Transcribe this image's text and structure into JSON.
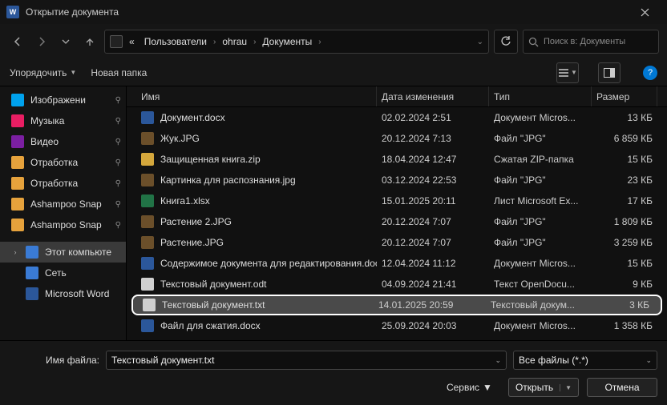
{
  "window": {
    "title": "Открытие документа"
  },
  "breadcrumbs": {
    "root": "«",
    "a": "Пользователи",
    "b": "ohrau",
    "c": "Документы"
  },
  "search": {
    "placeholder": "Поиск в: Документы"
  },
  "toolbar": {
    "organize": "Упорядочить",
    "newfolder": "Новая папка"
  },
  "columns": {
    "name": "Имя",
    "date": "Дата изменения",
    "type": "Тип",
    "size": "Размер"
  },
  "sidebar": {
    "items": [
      {
        "label": "Изображени",
        "icon": "#00a2ed",
        "pin": true
      },
      {
        "label": "Музыка",
        "icon": "#e91e63",
        "pin": true
      },
      {
        "label": "Видео",
        "icon": "#7b1fa2",
        "pin": true
      },
      {
        "label": "Отработка",
        "icon": "#e6a23c",
        "pin": true
      },
      {
        "label": "Отработка",
        "icon": "#e6a23c",
        "pin": true
      },
      {
        "label": "Ashampoo Snap",
        "icon": "#e6a23c",
        "pin": true
      },
      {
        "label": "Ashampoo Snap",
        "icon": "#e6a23c",
        "pin": true
      }
    ],
    "pc": {
      "label": "Этот компьюте",
      "icon": "#3a7bd5"
    },
    "net": {
      "label": "Сеть",
      "icon": "#3a7bd5"
    },
    "word": {
      "label": "Microsoft Word",
      "icon": "#2b579a"
    }
  },
  "files": [
    {
      "name": "Документ.docx",
      "date": "02.02.2024 2:51",
      "type": "Документ Micros...",
      "size": "13 КБ",
      "ic": "#2b579a"
    },
    {
      "name": "Жук.JPG",
      "date": "20.12.2024 7:13",
      "type": "Файл \"JPG\"",
      "size": "6 859 КБ",
      "ic": "#6b4f2a"
    },
    {
      "name": "Защищенная книга.zip",
      "date": "18.04.2024 12:47",
      "type": "Сжатая ZIP-папка",
      "size": "15 КБ",
      "ic": "#d4a73c"
    },
    {
      "name": "Картинка для распознания.jpg",
      "date": "03.12.2024 22:53",
      "type": "Файл \"JPG\"",
      "size": "23 КБ",
      "ic": "#6b4f2a"
    },
    {
      "name": "Книга1.xlsx",
      "date": "15.01.2025 20:11",
      "type": "Лист Microsoft Ex...",
      "size": "17 КБ",
      "ic": "#217346"
    },
    {
      "name": "Растение 2.JPG",
      "date": "20.12.2024 7:07",
      "type": "Файл \"JPG\"",
      "size": "1 809 КБ",
      "ic": "#6b4f2a"
    },
    {
      "name": "Растение.JPG",
      "date": "20.12.2024 7:07",
      "type": "Файл \"JPG\"",
      "size": "3 259 КБ",
      "ic": "#6b4f2a"
    },
    {
      "name": "Содержимое документа для редактирования.docx",
      "date": "12.04.2024 11:12",
      "type": "Документ Micros...",
      "size": "15 КБ",
      "ic": "#2b579a"
    },
    {
      "name": "Текстовый документ.odt",
      "date": "04.09.2024 21:41",
      "type": "Текст OpenDocu...",
      "size": "9 КБ",
      "ic": "#d0d0d0"
    },
    {
      "name": "Текстовый документ.txt",
      "date": "14.01.2025 20:59",
      "type": "Текстовый докум...",
      "size": "3 КБ",
      "ic": "#d0d0d0",
      "selected": true
    },
    {
      "name": "Файл для сжатия.docx",
      "date": "25.09.2024 20:03",
      "type": "Документ Micros...",
      "size": "1 358 КБ",
      "ic": "#2b579a"
    }
  ],
  "footer": {
    "filename_label": "Имя файла:",
    "filename_value": "Текстовый документ.txt",
    "filter": "Все файлы (*.*)",
    "service": "Сервис",
    "open": "Открыть",
    "cancel": "Отмена"
  }
}
